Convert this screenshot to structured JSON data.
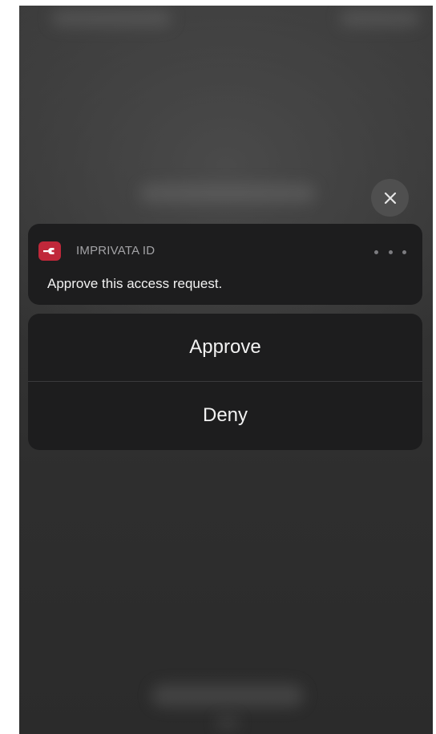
{
  "notification": {
    "app_name": "IMPRIVATA ID",
    "app_icon": "imprivata-logo-icon",
    "message": "Approve this access request.",
    "more_icon": "ellipsis-icon"
  },
  "actions": {
    "approve_label": "Approve",
    "deny_label": "Deny"
  },
  "close_icon": "close-icon",
  "colors": {
    "app_icon_background": "#c0283a",
    "card_background": "#1d1d1e",
    "close_button_background": "#4f4f4f",
    "text_primary": "#f2f2f2",
    "text_secondary": "#a3a3a6"
  }
}
